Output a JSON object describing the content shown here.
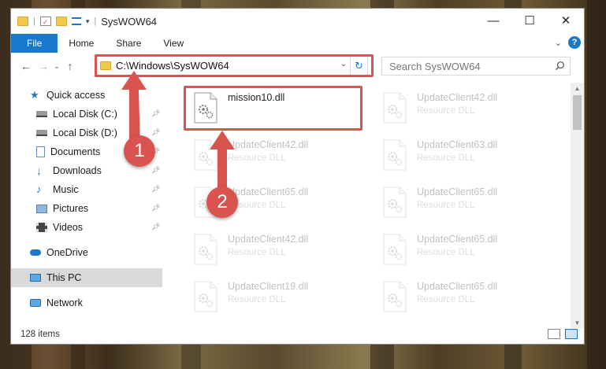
{
  "window": {
    "title": "SysWOW64",
    "controls": [
      "—",
      "☐",
      "✕"
    ]
  },
  "ribbon": {
    "tabs": [
      "File",
      "Home",
      "Share",
      "View"
    ],
    "help_label": "?"
  },
  "navbar": {
    "address": "C:\\Windows\\SysWOW64",
    "search_placeholder": "Search SysWOW64"
  },
  "sidebar": {
    "items": [
      {
        "label": "Quick access",
        "icon": "star-icon"
      },
      {
        "label": "Local Disk (C:)",
        "icon": "drive-icon",
        "pinned": true
      },
      {
        "label": "Local Disk (D:)",
        "icon": "drive-icon",
        "pinned": true
      },
      {
        "label": "Documents",
        "icon": "documents-icon",
        "pinned": true
      },
      {
        "label": "Downloads",
        "icon": "download-icon",
        "pinned": true
      },
      {
        "label": "Music",
        "icon": "music-icon",
        "pinned": true
      },
      {
        "label": "Pictures",
        "icon": "pictures-icon",
        "pinned": true
      },
      {
        "label": "Videos",
        "icon": "videos-icon",
        "pinned": true
      },
      {
        "label": "OneDrive",
        "icon": "cloud-icon"
      },
      {
        "label": "This PC",
        "icon": "computer-icon",
        "selected": true
      },
      {
        "label": "Network",
        "icon": "network-icon"
      }
    ]
  },
  "files": [
    {
      "name": "mission10.dll",
      "desc": "",
      "faded": false
    },
    {
      "name": "UpdateClient42.dll",
      "desc": "Resource DLL",
      "faded": true
    },
    {
      "name": "UpdateClient42.dll",
      "desc": "Resource DLL",
      "faded": true
    },
    {
      "name": "UpdateClient63.dll",
      "desc": "Resource DLL",
      "faded": true
    },
    {
      "name": "UpdateClient65.dll",
      "desc": "Resource DLL",
      "faded": true
    },
    {
      "name": "UpdateClient65.dll",
      "desc": "Resource DLL",
      "faded": true
    },
    {
      "name": "UpdateClient42.dll",
      "desc": "Resource DLL",
      "faded": true
    },
    {
      "name": "UpdateClient65.dll",
      "desc": "Resource DLL",
      "faded": true
    },
    {
      "name": "UpdateClient19.dll",
      "desc": "Resource DLL",
      "faded": true
    },
    {
      "name": "UpdateClient65.dll",
      "desc": "Resource DLL",
      "faded": true
    }
  ],
  "status": {
    "item_count": "128 items"
  },
  "annotations": {
    "step1": "1",
    "step2": "2"
  },
  "colors": {
    "accent": "#1979ca",
    "highlight": "#d9534f"
  }
}
